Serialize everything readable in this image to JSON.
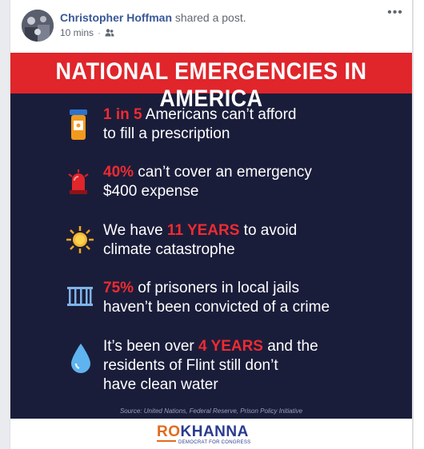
{
  "post": {
    "author": "Christopher Hoffman",
    "action": "shared a post.",
    "time": "10 mins",
    "separator": "·",
    "audience_icon": "friends-icon",
    "more_label": "•••"
  },
  "poster": {
    "title": "NATIONAL EMERGENCIES IN AMERICA",
    "colors": {
      "banner": "#e0252b",
      "background": "#1a1d3a",
      "highlight": "#ef2b31"
    },
    "facts": [
      {
        "icon": "pill-bottle-icon",
        "highlight": "1 in 5",
        "line1_rest": " Americans can’t afford",
        "line2": "to fill a prescription"
      },
      {
        "icon": "siren-icon",
        "highlight": "40%",
        "line1_rest": " can’t cover an emergency",
        "line2": "$400 expense"
      },
      {
        "icon": "sun-icon",
        "line1_pre": "We have ",
        "highlight": "11 YEARS",
        "line1_rest": " to avoid",
        "line2": "climate catastrophe"
      },
      {
        "icon": "jail-bars-icon",
        "highlight": "75%",
        "line1_rest": " of prisoners in local jails",
        "line2": "haven’t been convicted of a crime"
      },
      {
        "icon": "water-drop-icon",
        "line1_pre": "It’s been over ",
        "highlight": "4 YEARS",
        "line1_rest": " and the",
        "line2": "residents of Flint still don’t",
        "line3": "have clean water"
      }
    ],
    "source": "Source: United Nations, Federal Reserve, Prison Policy Initiative"
  },
  "logo": {
    "ro": "RO",
    "khanna": "KHANNA",
    "subtitle": "DEMOCRAT FOR CONGRESS"
  }
}
